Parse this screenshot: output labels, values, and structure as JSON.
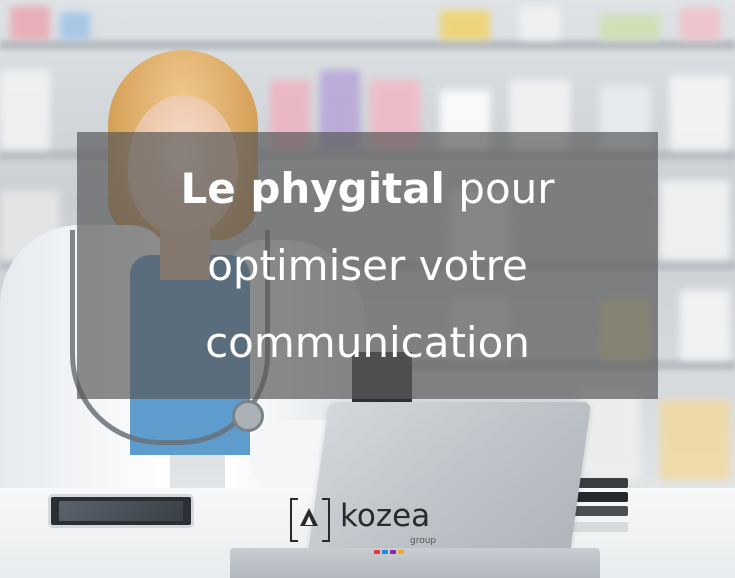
{
  "headline": {
    "line1_bold": "Le phygital",
    "line1_rest": " pour",
    "line2": "optimiser votre",
    "line3": "communication"
  },
  "logo": {
    "word": "kozea",
    "sub": "group",
    "dot_colors": [
      "#e53935",
      "#1e88e5",
      "#8e24aa",
      "#f9a825"
    ]
  },
  "colors": {
    "overlay": "#5a5a5a",
    "text": "#ffffff"
  }
}
